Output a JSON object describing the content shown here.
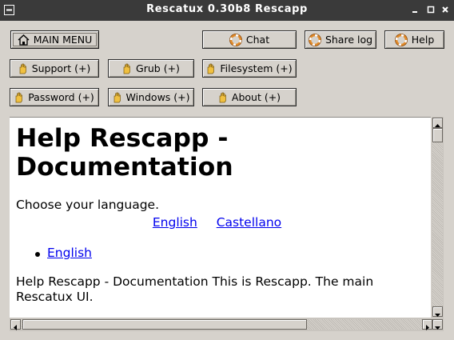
{
  "window": {
    "title": "Rescatux 0.30b8 Rescapp"
  },
  "toolbar": {
    "main_menu": "MAIN MENU",
    "chat": "Chat",
    "share_log": "Share log",
    "help": "Help",
    "support": "Support (+)",
    "grub": "Grub (+)",
    "filesystem": "Filesystem (+)",
    "password": "Password (+)",
    "windows": "Windows (+)",
    "about": "About (+)"
  },
  "content": {
    "heading": "Help Rescapp - Documentation",
    "choose_language": "Choose your language.",
    "lang_links": [
      "English",
      "Castellano"
    ],
    "list_items": [
      "English"
    ],
    "paragraph": "Help Rescapp - Documentation This is Rescapp. The main Rescatux UI."
  },
  "colors": {
    "link": "#0000ee",
    "titlebar": "#3a3a3a",
    "window_bg": "#d6d2cc"
  },
  "icons": {
    "main_menu": "home-icon",
    "chat": "lifebuoy-icon",
    "share_log": "lifebuoy-icon",
    "help": "lifebuoy-icon",
    "category": "hand-icon"
  }
}
